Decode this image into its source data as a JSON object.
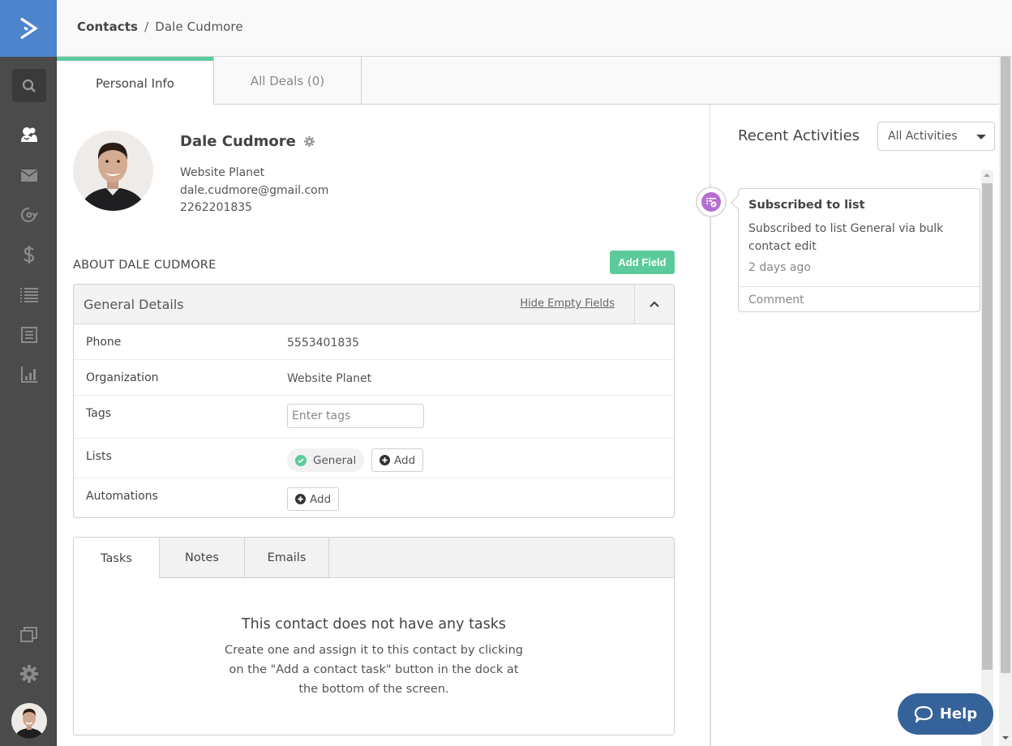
{
  "app": {
    "brand_color": "#4d84cc",
    "accent_color": "#5ccb9b",
    "sidebar": {
      "items": [
        {
          "name": "search",
          "icon": "search-icon"
        },
        {
          "name": "contacts",
          "icon": "contacts-icon",
          "active": true
        },
        {
          "name": "campaigns",
          "icon": "envelope-icon"
        },
        {
          "name": "automations",
          "icon": "automation-cycle-icon"
        },
        {
          "name": "deals",
          "icon": "dollar-icon"
        },
        {
          "name": "lists",
          "icon": "list-icon"
        },
        {
          "name": "forms",
          "icon": "form-icon"
        },
        {
          "name": "reports",
          "icon": "bar-chart-icon"
        },
        {
          "name": "apps",
          "icon": "windows-icon"
        },
        {
          "name": "settings",
          "icon": "gear-icon"
        }
      ]
    }
  },
  "breadcrumb": {
    "root": "Contacts",
    "separator": "/",
    "current": "Dale Cudmore"
  },
  "tabs": [
    {
      "label": "Personal Info",
      "active": true
    },
    {
      "label": "All Deals (0)",
      "active": false
    }
  ],
  "contact": {
    "name": "Dale Cudmore",
    "organization": "Website Planet",
    "email": "dale.cudmore@gmail.com",
    "phone": "2262201835"
  },
  "about": {
    "title": "ABOUT DALE CUDMORE",
    "add_field_label": "Add Field"
  },
  "general_details": {
    "title": "General Details",
    "hide_empty_label": "Hide Empty Fields",
    "fields": {
      "phone": {
        "label": "Phone",
        "value": "5553401835"
      },
      "organization": {
        "label": "Organization",
        "value": "Website Planet"
      },
      "tags": {
        "label": "Tags",
        "placeholder": "Enter tags",
        "value": ""
      },
      "lists": {
        "label": "Lists",
        "chip": "General",
        "add_label": "Add"
      },
      "automations": {
        "label": "Automations",
        "add_label": "Add"
      }
    }
  },
  "task_panel": {
    "tabs": [
      {
        "label": "Tasks",
        "active": true
      },
      {
        "label": "Notes",
        "active": false
      },
      {
        "label": "Emails",
        "active": false
      }
    ],
    "empty_title": "This contact does not have any tasks",
    "empty_body": "Create one and assign it to this contact by clicking on the \"Add a contact task\" button in the dock at the bottom of the screen."
  },
  "activities": {
    "title": "Recent Activities",
    "filter": "All Activities",
    "items": [
      {
        "title": "Subscribed to list",
        "description": "Subscribed to list General via bulk contact edit",
        "time": "2 days ago",
        "comment_placeholder": "Comment",
        "icon": "list-subscribe-icon",
        "icon_color": "#b56fd0"
      }
    ]
  },
  "help": {
    "label": "Help"
  }
}
